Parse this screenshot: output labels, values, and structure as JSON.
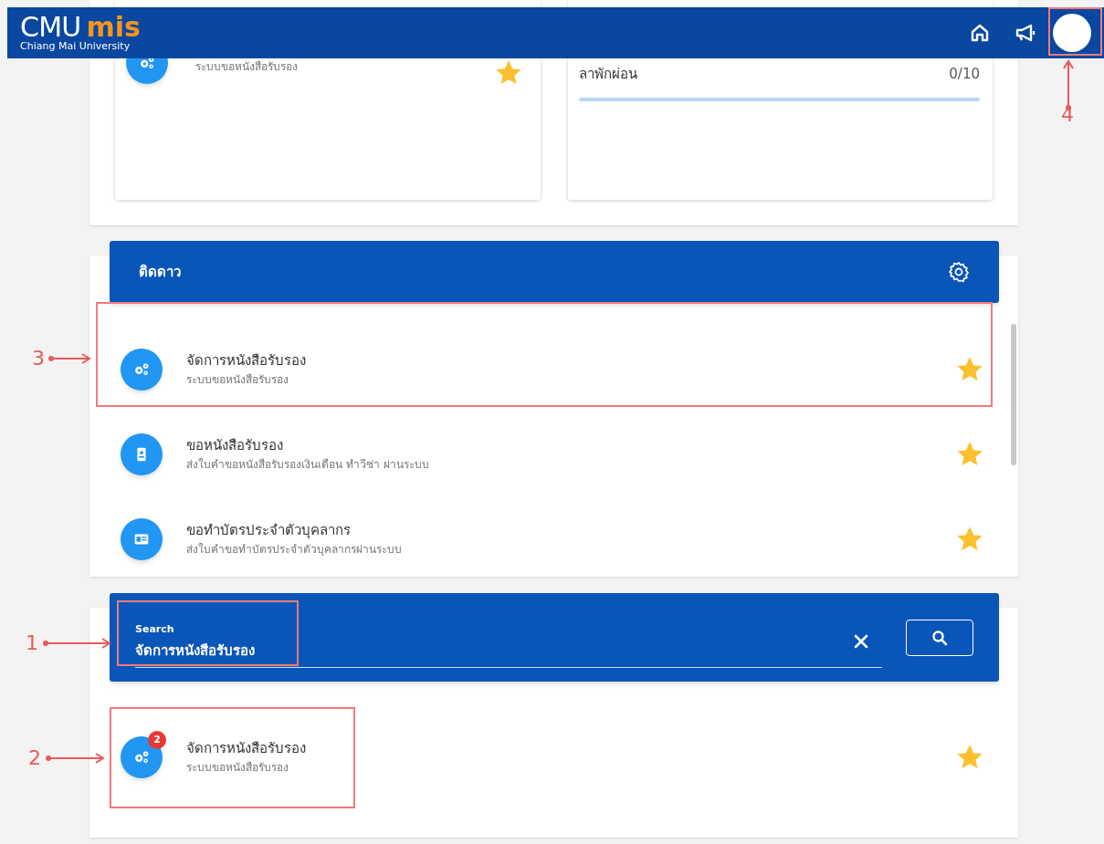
{
  "header": {
    "logo_main": "CMU",
    "logo_accent": "mis",
    "logo_subtitle": "Chiang Mai University"
  },
  "top_cards": [
    {
      "kind": "app",
      "subtitle": "ระบบขอหนังสือรับรอง",
      "starred": true
    },
    {
      "kind": "leave",
      "label": "ลาพักผ่อน",
      "count": "0/10",
      "level": 0
    }
  ],
  "favorites": {
    "title": "ติดดาว",
    "items": [
      {
        "title": "จัดการหนังสือรับรอง",
        "subtitle": "ระบบขอหนังสือรับรอง",
        "kind": "gears",
        "starred": true
      },
      {
        "title": "ขอหนังสือรับรอง",
        "subtitle": "ส่งใบคำขอหนังสือรับรองเงินเดือน ทำวีซ่า ผ่านระบบ",
        "kind": "badge",
        "starred": true
      },
      {
        "title": "ขอทำบัตรประจำตัวบุคลากร",
        "subtitle": "ส่งใบคำขอทำบัตรประจำตัวบุคลากรผ่านระบบ",
        "kind": "card",
        "starred": true
      }
    ]
  },
  "search": {
    "label": "Search",
    "value": "จัดการหนังสือรับรอง",
    "results": [
      {
        "title": "จัดการหนังสือรับรอง",
        "subtitle": "ระบบขอหนังสือรับรอง",
        "kind": "gears",
        "badge": "2",
        "starred": true
      }
    ]
  },
  "annotations": [
    {
      "label": "4"
    },
    {
      "label": "3"
    },
    {
      "label": "1"
    },
    {
      "label": "2"
    }
  ]
}
